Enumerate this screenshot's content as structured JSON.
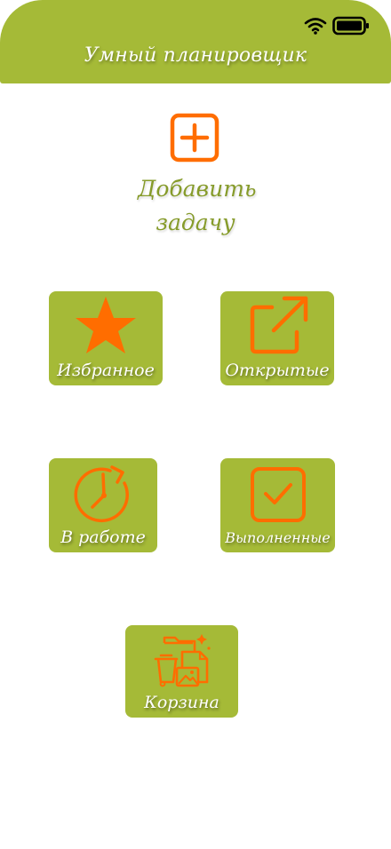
{
  "app": {
    "title": "Умный планировщик"
  },
  "status_bar": {
    "icons": [
      "wifi-icon",
      "battery-icon"
    ]
  },
  "add_task": {
    "label": "Добавить задачу",
    "icon": "plus-square-icon"
  },
  "tiles": [
    {
      "label": "Избранное",
      "icon": "star-icon"
    },
    {
      "label": "Открытые",
      "icon": "external-link-icon"
    },
    {
      "label": "В работе",
      "icon": "clock-refresh-icon"
    },
    {
      "label": "Выполненные",
      "icon": "check-square-icon"
    },
    {
      "label": "Корзина",
      "icon": "trash-files-icon"
    }
  ],
  "colors": {
    "accent_green": "#a5ba37",
    "icon_orange": "#ff6d00",
    "text_green": "#869b2a",
    "white": "#ffffff"
  }
}
